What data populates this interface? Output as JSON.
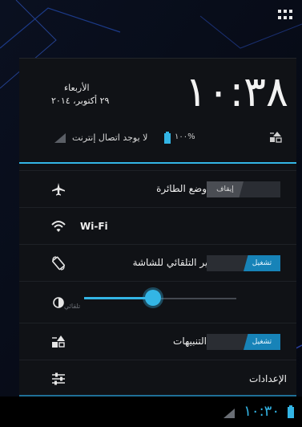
{
  "header": {
    "clock": "١٠:٣٨",
    "day": "الأربعاء",
    "date": "٢٩ أكتوبر، ٢٠١٤",
    "network_status": "لا يوجد اتصال إنترنت",
    "battery_percent": "١٠٠%"
  },
  "quick_settings": [
    {
      "id": "airplane",
      "label": "وضع الطائرة",
      "toggle": "إيقاف",
      "state": "off",
      "icon": "airplane-icon"
    },
    {
      "id": "wifi",
      "label": "Wi-Fi",
      "icon": "wifi-icon"
    },
    {
      "id": "rotation",
      "label": "التدوير التلقائي للشاشة",
      "toggle": "تشغيل",
      "state": "on",
      "icon": "rotation-icon"
    },
    {
      "id": "brightness",
      "auto_label": "تلقائي",
      "level": 0.45,
      "icon": "brightness-icon"
    },
    {
      "id": "notifications",
      "label": "التنبيهات",
      "toggle": "تشغيل",
      "state": "on",
      "icon": "notifications-icon"
    },
    {
      "id": "settings",
      "label": "الإعدادات",
      "icon": "settings-sliders-icon"
    }
  ],
  "navbar": {
    "clock": "١٠:٣٠"
  },
  "colors": {
    "accent": "#33b5e5",
    "panel": "#101216",
    "toggle_on": "#1783b8"
  }
}
